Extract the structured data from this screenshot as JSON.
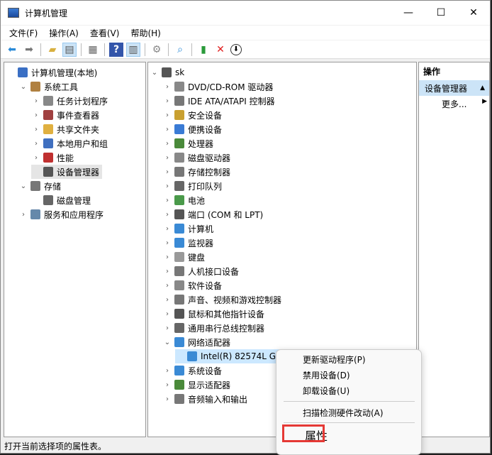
{
  "window": {
    "title": "计算机管理",
    "minimize": "—",
    "maximize": "☐",
    "close": "✕"
  },
  "menu": [
    "文件(F)",
    "操作(A)",
    "查看(V)",
    "帮助(H)"
  ],
  "toolbar": [
    "back-arrow",
    "forward-arrow",
    "up-folder",
    "show-hide-tree",
    "properties",
    "help",
    "show-action-pane",
    "update-driver",
    "scan-hardware",
    "enable-device",
    "uninstall-device",
    "disable-device"
  ],
  "left_tree": [
    {
      "label": "计算机管理(本地)",
      "level": 0,
      "exp": "",
      "color": "#3a6fc4"
    },
    {
      "label": "系统工具",
      "level": 1,
      "exp": "⌄",
      "color": "#b08040"
    },
    {
      "label": "任务计划程序",
      "level": 2,
      "exp": "›",
      "color": "#888"
    },
    {
      "label": "事件查看器",
      "level": 2,
      "exp": "›",
      "color": "#a04040"
    },
    {
      "label": "共享文件夹",
      "level": 2,
      "exp": "›",
      "color": "#e0b040"
    },
    {
      "label": "本地用户和组",
      "level": 2,
      "exp": "›",
      "color": "#4070c0"
    },
    {
      "label": "性能",
      "level": 2,
      "exp": "›",
      "color": "#c03030"
    },
    {
      "label": "设备管理器",
      "level": 2,
      "exp": "",
      "color": "#555",
      "selected": true
    },
    {
      "label": "存储",
      "level": 1,
      "exp": "⌄",
      "color": "#777"
    },
    {
      "label": "磁盘管理",
      "level": 2,
      "exp": "",
      "color": "#666"
    },
    {
      "label": "服务和应用程序",
      "level": 1,
      "exp": "›",
      "color": "#6688aa"
    }
  ],
  "device_tree": [
    {
      "label": "sk",
      "level": 0,
      "exp": "⌄",
      "color": "#555"
    },
    {
      "label": "DVD/CD-ROM 驱动器",
      "level": 1,
      "exp": "›",
      "color": "#888"
    },
    {
      "label": "IDE ATA/ATAPI 控制器",
      "level": 1,
      "exp": "›",
      "color": "#777"
    },
    {
      "label": "安全设备",
      "level": 1,
      "exp": "›",
      "color": "#c9a030"
    },
    {
      "label": "便携设备",
      "level": 1,
      "exp": "›",
      "color": "#3a7bd5"
    },
    {
      "label": "处理器",
      "level": 1,
      "exp": "›",
      "color": "#4a8a3a"
    },
    {
      "label": "磁盘驱动器",
      "level": 1,
      "exp": "›",
      "color": "#888"
    },
    {
      "label": "存储控制器",
      "level": 1,
      "exp": "›",
      "color": "#777"
    },
    {
      "label": "打印队列",
      "level": 1,
      "exp": "›",
      "color": "#666"
    },
    {
      "label": "电池",
      "level": 1,
      "exp": "›",
      "color": "#4a9a4a"
    },
    {
      "label": "端口 (COM 和 LPT)",
      "level": 1,
      "exp": "›",
      "color": "#555"
    },
    {
      "label": "计算机",
      "level": 1,
      "exp": "›",
      "color": "#3a8ad5"
    },
    {
      "label": "监视器",
      "level": 1,
      "exp": "›",
      "color": "#3a8ad5"
    },
    {
      "label": "键盘",
      "level": 1,
      "exp": "›",
      "color": "#999"
    },
    {
      "label": "人机接口设备",
      "level": 1,
      "exp": "›",
      "color": "#777"
    },
    {
      "label": "软件设备",
      "level": 1,
      "exp": "›",
      "color": "#888"
    },
    {
      "label": "声音、视频和游戏控制器",
      "level": 1,
      "exp": "›",
      "color": "#777"
    },
    {
      "label": "鼠标和其他指针设备",
      "level": 1,
      "exp": "›",
      "color": "#555"
    },
    {
      "label": "通用串行总线控制器",
      "level": 1,
      "exp": "›",
      "color": "#666"
    },
    {
      "label": "网络适配器",
      "level": 1,
      "exp": "⌄",
      "color": "#3a8ad5"
    },
    {
      "label": "Intel(R) 82574L Gigabit Network Connection",
      "level": 2,
      "exp": "",
      "color": "#3a8ad5",
      "selected": true
    },
    {
      "label": "系统设备",
      "level": 1,
      "exp": "›",
      "color": "#3a8ad5"
    },
    {
      "label": "显示适配器",
      "level": 1,
      "exp": "›",
      "color": "#4a8a3a"
    },
    {
      "label": "音频输入和输出",
      "level": 1,
      "exp": "›",
      "color": "#777"
    }
  ],
  "actions": {
    "header": "操作",
    "section": "设备管理器",
    "more": "更多...",
    "section_arrow": "▲",
    "more_arrow": "▶"
  },
  "context_menu": {
    "items": [
      "更新驱动程序(P)",
      "禁用设备(D)",
      "卸载设备(U)",
      "扫描检测硬件改动(A)",
      "属性"
    ],
    "highlight_color": "#e53935"
  },
  "status": "打开当前选择项的属性表。"
}
